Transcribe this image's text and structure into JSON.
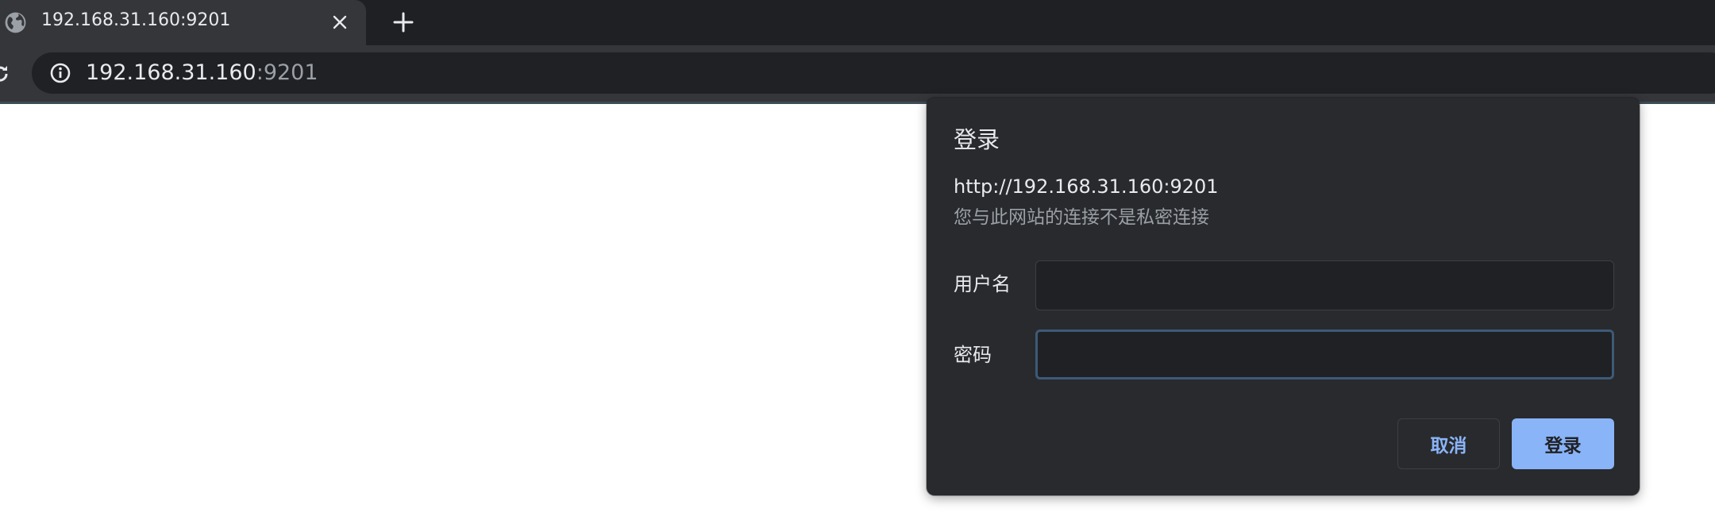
{
  "tab": {
    "title": "192.168.31.160:9201"
  },
  "toolbar": {
    "url_host": "192.168.31.160",
    "url_port": ":9201"
  },
  "dialog": {
    "title": "登录",
    "origin": "http://192.168.31.160:9201",
    "warning": "您与此网站的连接不是私密连接",
    "username_label": "用户名",
    "username_value": "",
    "password_label": "密码",
    "password_value": "",
    "cancel_label": "取消",
    "signin_label": "登录"
  },
  "icons": {
    "tab_favicon": "globe-icon",
    "tab_close": "close-icon",
    "new_tab": "plus-icon",
    "reload": "reload-icon",
    "site_info": "info-icon"
  },
  "colors": {
    "tabstrip_bg": "#1f2023",
    "toolbar_bg": "#35363a",
    "omnibox_bg": "#202124",
    "dialog_bg": "#292a2d",
    "accent": "#8ab4f8",
    "focus_ring": "#3d5a78",
    "text_primary": "#e8eaed",
    "text_secondary": "#9aa0a6"
  }
}
